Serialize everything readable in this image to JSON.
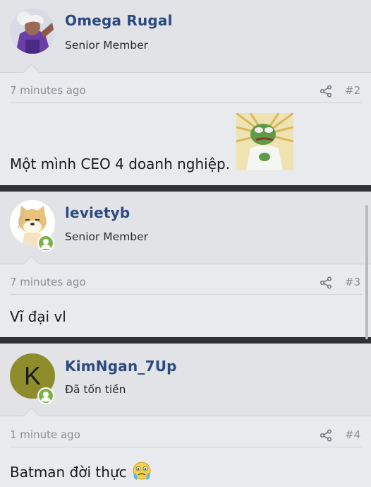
{
  "posts": [
    {
      "username": "Omega Rugal",
      "role": "Senior Member",
      "time": "7 minutes ago",
      "number": "#2",
      "content": "Một mình CEO 4 doanh nghiệp."
    },
    {
      "username": "levietyb",
      "role": "Senior Member",
      "time": "7 minutes ago",
      "number": "#3",
      "content": "Vĩ đại vl"
    },
    {
      "username": "KimNgan_7Up",
      "avatar_letter": "K",
      "role": "Đã tốn tiền",
      "time": "1 minute ago",
      "number": "#4",
      "content": "Batman đời thực"
    }
  ],
  "colors": {
    "username": "#2c4a80",
    "online": "#7bb24a",
    "divider": "#2e3238",
    "kim_avatar": "#8f8c2b"
  },
  "icons": [
    "share-icon",
    "online-status-icon",
    "pepe-sticker-image",
    "crying-emoji-icon"
  ]
}
